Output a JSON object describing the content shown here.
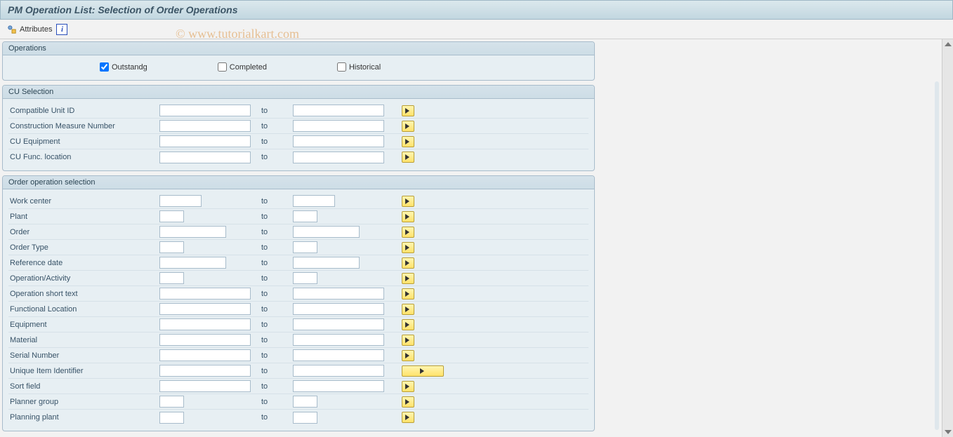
{
  "header": {
    "title": "PM Operation List: Selection of Order Operations"
  },
  "toolbar": {
    "attributes_label": "Attributes"
  },
  "watermark": "© www.tutorialkart.com",
  "groups": {
    "operations": {
      "title": "Operations",
      "checkboxes": {
        "outstanding": {
          "label": "Outstandg",
          "checked": true
        },
        "completed": {
          "label": "Completed",
          "checked": false
        },
        "historical": {
          "label": "Historical",
          "checked": false
        }
      }
    },
    "cu_selection": {
      "title": "CU Selection",
      "fields": [
        {
          "label": "Compatible Unit ID",
          "from_w": "w130",
          "to_w": "w130"
        },
        {
          "label": "Construction Measure Number",
          "from_w": "w130",
          "to_w": "w130"
        },
        {
          "label": "CU Equipment",
          "from_w": "w130",
          "to_w": "w130"
        },
        {
          "label": "CU Func. location",
          "from_w": "w130",
          "to_w": "w130"
        }
      ]
    },
    "order_op_selection": {
      "title": "Order operation selection",
      "fields": [
        {
          "label": "Work center",
          "from_w": "w60",
          "to_w": "w60"
        },
        {
          "label": "Plant",
          "from_w": "w35",
          "to_w": "w35"
        },
        {
          "label": "Order",
          "from_w": "w95",
          "to_w": "w95"
        },
        {
          "label": "Order Type",
          "from_w": "w35",
          "to_w": "w35"
        },
        {
          "label": "Reference date",
          "from_w": "w95",
          "to_w": "w95"
        },
        {
          "label": "Operation/Activity",
          "from_w": "w35",
          "to_w": "w35"
        },
        {
          "label": "Operation short text",
          "from_w": "w130",
          "to_w": "w130"
        },
        {
          "label": "Functional Location",
          "from_w": "w130",
          "to_w": "w130"
        },
        {
          "label": "Equipment",
          "from_w": "w130",
          "to_w": "w130"
        },
        {
          "label": "Material",
          "from_w": "w130",
          "to_w": "w130"
        },
        {
          "label": "Serial Number",
          "from_w": "w130",
          "to_w": "w130"
        },
        {
          "label": "Unique Item Identifier",
          "from_w": "w130",
          "to_w": "w130",
          "wide_btn": true
        },
        {
          "label": "Sort field",
          "from_w": "w130",
          "to_w": "w130"
        },
        {
          "label": "Planner group",
          "from_w": "w35",
          "to_w": "w35"
        },
        {
          "label": "Planning plant",
          "from_w": "w35",
          "to_w": "w35"
        }
      ]
    }
  },
  "shared": {
    "to_label": "to"
  }
}
